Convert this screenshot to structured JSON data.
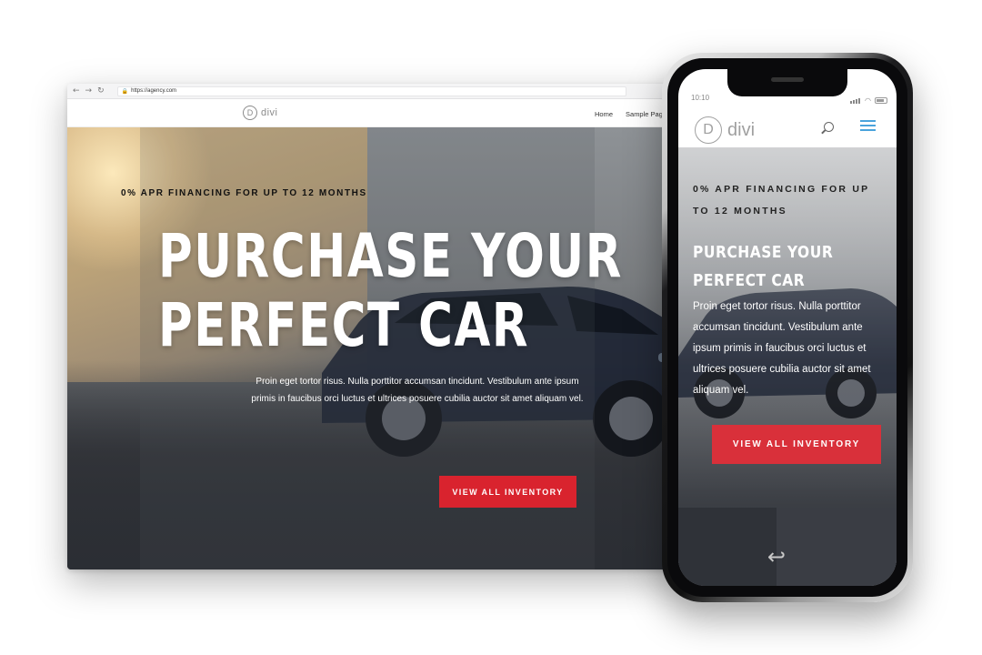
{
  "browser": {
    "url": "https://agency.com",
    "nav": {
      "back": "←",
      "forward": "→",
      "reload": "↻",
      "lock": "🔒"
    }
  },
  "site": {
    "logo_letter": "D",
    "logo_text": "divi",
    "menu": [
      "Home",
      "Sample Page"
    ]
  },
  "hero": {
    "tagline": "0% APR FINANCING FOR UP TO 12 MONTHS",
    "title_line1": "PURCHASE YOUR",
    "title_line2": "PERFECT CAR",
    "body_line1": "Proin eget tortor risus. Nulla porttitor accumsan tincidunt. Vestibulum ante ipsum",
    "body_line2": "primis in faucibus orci luctus et ultrices posuere cubilia auctor sit amet aliquam vel.",
    "button": "VIEW ALL INVENTORY"
  },
  "phone": {
    "time": "10:10",
    "logo_letter": "D",
    "logo_text": "divi",
    "tagline": "0% APR FINANCING FOR UP TO 12 MONTHS",
    "title": "PURCHASE YOUR PERFECT CAR",
    "body": "Proin eget tortor risus. Nulla porttitor accumsan tincidunt. Vestibulum ante ipsum primis in faucibus orci luctus et ultrices posuere cubilia auctor sit amet aliquam vel.",
    "button": "VIEW ALL INVENTORY",
    "back_glyph": "↩"
  },
  "colors": {
    "accent_red": "#d9232e",
    "menu_blue": "#4aa3dc",
    "logo_gray": "#8a8a8a"
  },
  "icons": [
    "back-arrow-icon",
    "forward-arrow-icon",
    "reload-icon",
    "lock-icon",
    "search-icon",
    "hamburger-menu-icon",
    "signal-icon",
    "wifi-icon",
    "battery-icon",
    "back-icon"
  ]
}
